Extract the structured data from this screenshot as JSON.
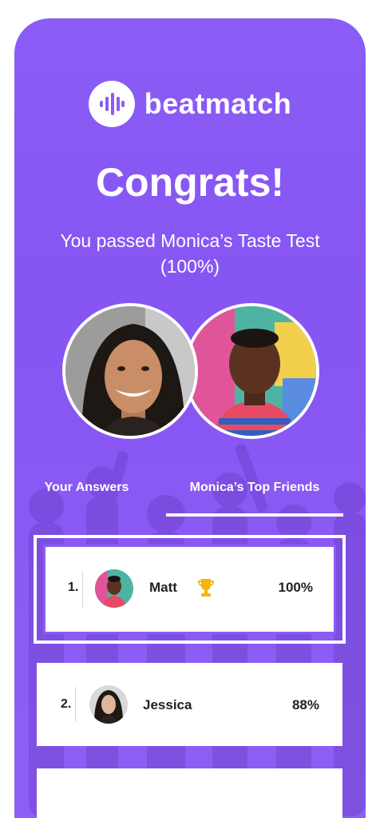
{
  "brand": {
    "name": "beatmatch",
    "logo_icon": "soundwave-icon"
  },
  "hero": {
    "headline": "Congrats!",
    "subhead": "You passed Monica’s Taste Test (100%)"
  },
  "tabs": [
    {
      "label": "Your Answers",
      "active": false
    },
    {
      "label": "Monica’s Top Friends",
      "active": true
    }
  ],
  "leaderboard": [
    {
      "rank": "1.",
      "name": "Matt",
      "percent": "100%",
      "badge": "trophy-icon",
      "highlighted": true
    },
    {
      "rank": "2.",
      "name": "Jessica",
      "percent": "88%",
      "badge": "",
      "highlighted": false
    }
  ],
  "colors": {
    "accent": "#8b5cf6",
    "trophy": "#f2b705",
    "card": "#ffffff"
  }
}
